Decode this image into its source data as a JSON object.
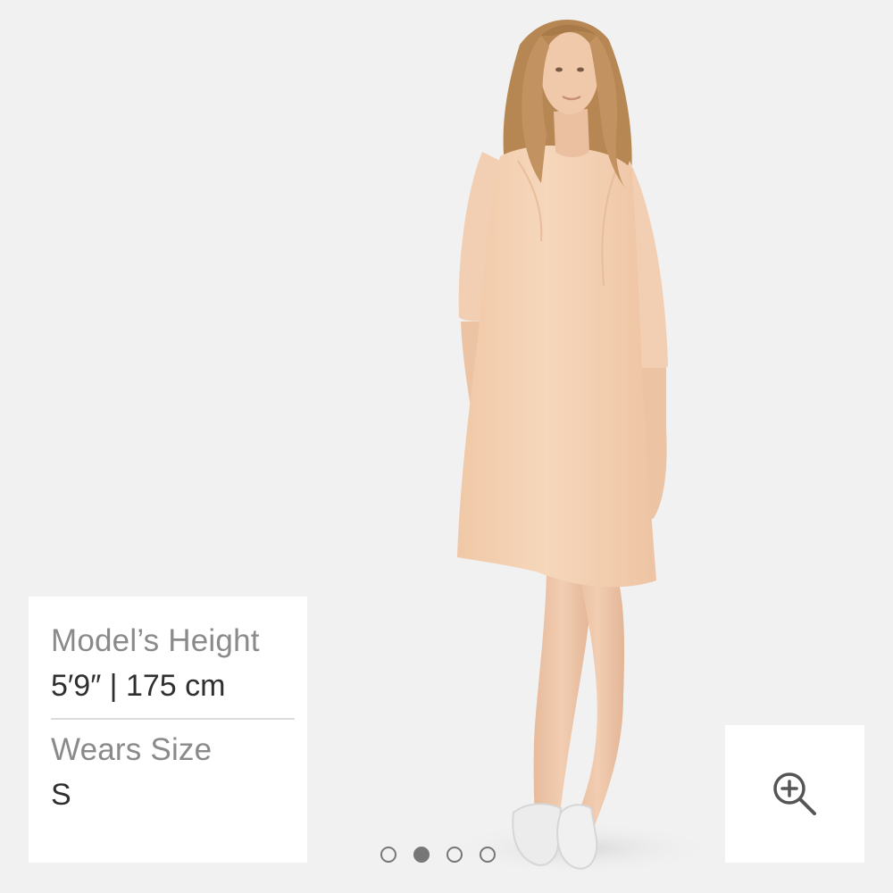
{
  "model_info": {
    "height_label": "Model’s Height",
    "height_value": "5′9″ | 175 cm",
    "size_label": "Wears Size",
    "size_value": "S"
  },
  "zoom": {
    "icon": "zoom-in-icon"
  },
  "carousel": {
    "total": 4,
    "active_index": 1
  },
  "colors": {
    "background": "#f1f1f1",
    "dress": "#f4cfb0",
    "hair": "#b98a55",
    "skin": "#efc7a9",
    "shoes": "#ececec",
    "label_gray": "#8a8a8a",
    "value_dark": "#2f2f2f"
  }
}
